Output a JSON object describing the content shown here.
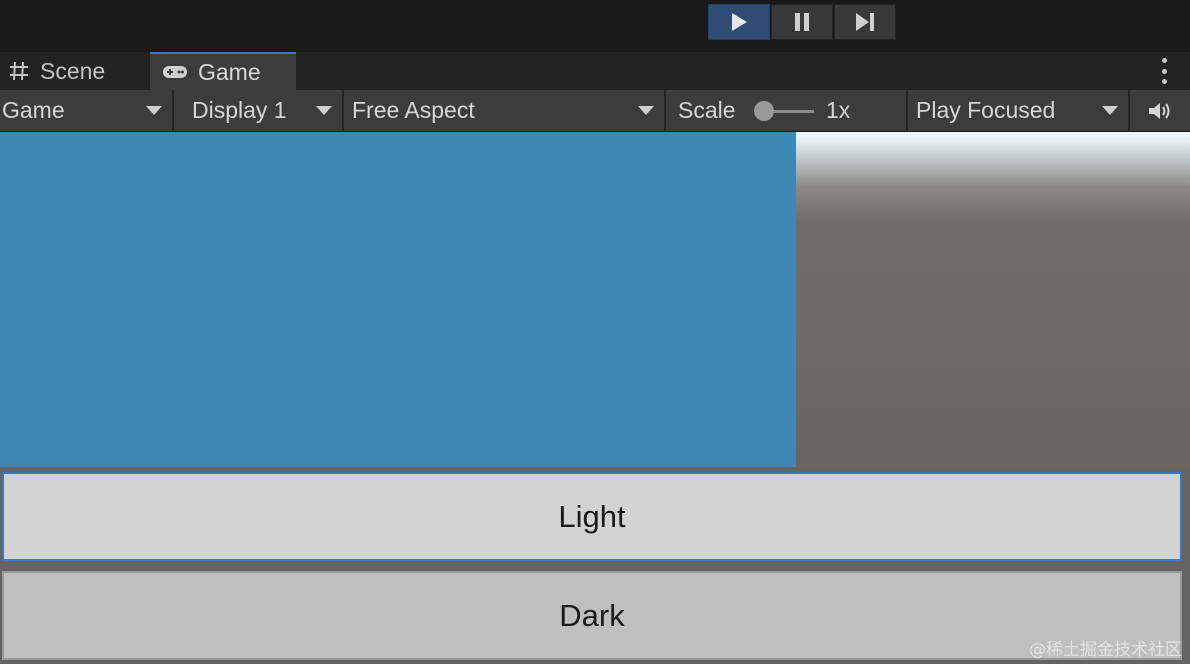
{
  "toolbar": {
    "play_icon": "play-icon",
    "pause_icon": "pause-icon",
    "step_icon": "step-icon",
    "play_active": true
  },
  "tabs": [
    {
      "label": "Scene",
      "icon": "hash-icon"
    },
    {
      "label": "Game",
      "icon": "gamepad-icon",
      "active": true
    }
  ],
  "game_toolbar": {
    "view_label": "Game",
    "display_label": "Display 1",
    "aspect_label": "Free Aspect",
    "scale_label": "Scale",
    "scale_value": "1x",
    "focus_label": "Play Focused",
    "audio_icon": "speaker-icon"
  },
  "viewport": {
    "panel_color": "#3d88b5",
    "buttons": {
      "light_label": "Light",
      "dark_label": "Dark"
    }
  },
  "watermark": "@稀土掘金技术社区",
  "colors": {
    "accent": "#3a79bb",
    "play_active_bg": "#2f4d74"
  }
}
